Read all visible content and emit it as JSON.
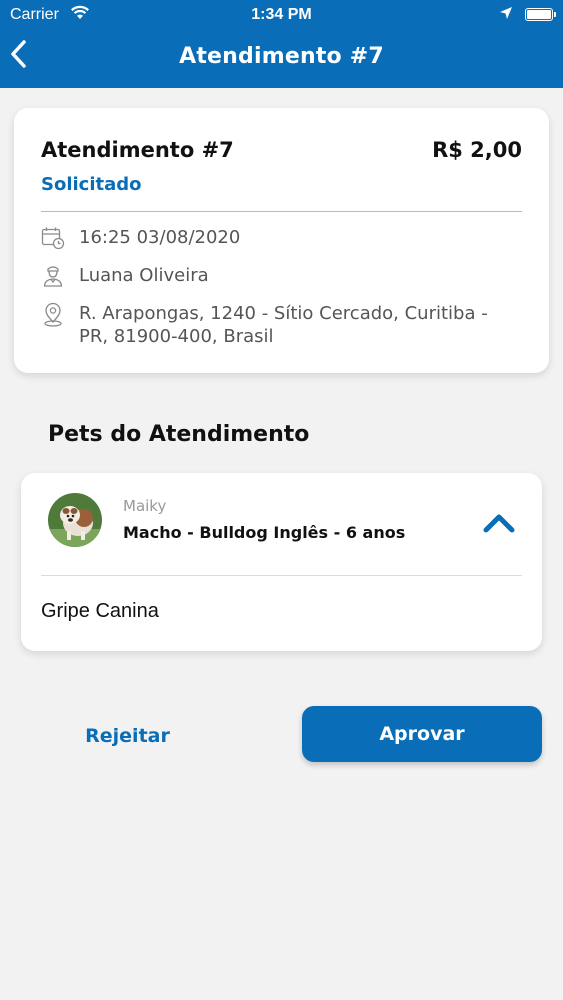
{
  "status_bar": {
    "carrier": "Carrier",
    "time": "1:34 PM"
  },
  "nav": {
    "title": "Atendimento #7"
  },
  "service": {
    "title": "Atendimento #7",
    "price": "R$ 2,00",
    "status": "Solicitado",
    "datetime": "16:25 03/08/2020",
    "professional": "Luana Oliveira",
    "address": "R. Arapongas, 1240 - Sítio Cercado, Curitiba - PR, 81900-400, Brasil"
  },
  "pets_section": {
    "title": "Pets do Atendimento"
  },
  "pet": {
    "name": "Maiky",
    "description": "Macho - Bulldog Inglês - 6 anos",
    "condition": "Gripe Canina"
  },
  "actions": {
    "reject_label": "Rejeitar",
    "approve_label": "Aprovar"
  },
  "colors": {
    "primary": "#0a6db8",
    "background": "#f2f2f2"
  },
  "icons": [
    "wifi-icon",
    "location-arrow-icon",
    "battery-icon",
    "back-chevron-icon",
    "calendar-clock-icon",
    "person-icon",
    "map-pin-icon",
    "chevron-up-icon"
  ]
}
